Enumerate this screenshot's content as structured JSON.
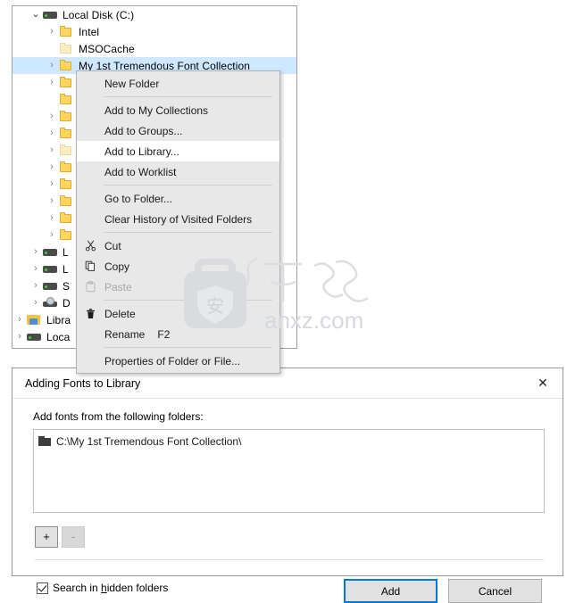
{
  "tree": {
    "rows": [
      {
        "label": "Local Disk (C:)",
        "icon": "drive-icon",
        "indent": 1,
        "twisty": "expanded",
        "selected": false
      },
      {
        "label": "Intel",
        "icon": "folder-icon",
        "indent": 2,
        "twisty": "collapsed",
        "selected": false
      },
      {
        "label": "MSOCache",
        "icon": "folder-pale-icon",
        "indent": 2,
        "twisty": "none",
        "selected": false
      },
      {
        "label": "My 1st Tremendous Font Collection",
        "icon": "folder-icon",
        "indent": 2,
        "twisty": "collapsed",
        "selected": true
      },
      {
        "label": "",
        "icon": "folder-icon",
        "indent": 2,
        "twisty": "collapsed",
        "selected": false
      },
      {
        "label": "",
        "icon": "folder-icon",
        "indent": 2,
        "twisty": "none",
        "selected": false
      },
      {
        "label": "",
        "icon": "folder-icon",
        "indent": 2,
        "twisty": "collapsed",
        "selected": false
      },
      {
        "label": "",
        "icon": "folder-icon",
        "indent": 2,
        "twisty": "collapsed",
        "selected": false
      },
      {
        "label": "",
        "icon": "folder-pale-icon",
        "indent": 2,
        "twisty": "collapsed",
        "selected": false
      },
      {
        "label": "",
        "icon": "folder-icon",
        "indent": 2,
        "twisty": "collapsed",
        "selected": false
      },
      {
        "label": "",
        "icon": "folder-icon",
        "indent": 2,
        "twisty": "collapsed",
        "selected": false
      },
      {
        "label": "",
        "icon": "folder-icon",
        "indent": 2,
        "twisty": "collapsed",
        "selected": false
      },
      {
        "label": "",
        "icon": "folder-icon",
        "indent": 2,
        "twisty": "collapsed",
        "selected": false
      },
      {
        "label": "",
        "icon": "folder-icon",
        "indent": 2,
        "twisty": "collapsed",
        "selected": false
      },
      {
        "label": "L",
        "icon": "drive-icon",
        "indent": 1,
        "twisty": "collapsed",
        "selected": false
      },
      {
        "label": "L",
        "icon": "drive-icon",
        "indent": 1,
        "twisty": "collapsed",
        "selected": false
      },
      {
        "label": "S",
        "icon": "drive-icon",
        "indent": 1,
        "twisty": "collapsed",
        "selected": false
      },
      {
        "label": "D",
        "icon": "disc-icon",
        "indent": 1,
        "twisty": "collapsed",
        "selected": false
      },
      {
        "label": "Libra",
        "icon": "library-icon",
        "indent": 0,
        "twisty": "collapsed",
        "selected": false
      },
      {
        "label": "Loca",
        "icon": "drive-icon",
        "indent": 0,
        "twisty": "collapsed",
        "selected": false
      },
      {
        "label": "Loca",
        "icon": "drive-icon",
        "indent": 0,
        "twisty": "collapsed",
        "selected": false
      }
    ]
  },
  "context_menu": {
    "items": [
      {
        "label": "New Folder",
        "icon": "",
        "hovered": false,
        "disabled": false,
        "shortcut": ""
      },
      {
        "separator": true
      },
      {
        "label": "Add to My Collections",
        "icon": "",
        "hovered": false,
        "disabled": false,
        "shortcut": ""
      },
      {
        "label": "Add to Groups...",
        "icon": "",
        "hovered": false,
        "disabled": false,
        "shortcut": ""
      },
      {
        "label": "Add to Library...",
        "icon": "",
        "hovered": true,
        "disabled": false,
        "shortcut": ""
      },
      {
        "label": "Add to Worklist",
        "icon": "",
        "hovered": false,
        "disabled": false,
        "shortcut": ""
      },
      {
        "separator": true
      },
      {
        "label": "Go to Folder...",
        "icon": "",
        "hovered": false,
        "disabled": false,
        "shortcut": ""
      },
      {
        "label": "Clear History of Visited Folders",
        "icon": "",
        "hovered": false,
        "disabled": false,
        "shortcut": ""
      },
      {
        "separator": true
      },
      {
        "label": "Cut",
        "icon": "cut-icon",
        "glyph": "✂",
        "hovered": false,
        "disabled": false,
        "shortcut": ""
      },
      {
        "label": "Copy",
        "icon": "copy-icon",
        "glyph": "❐",
        "hovered": false,
        "disabled": false,
        "shortcut": ""
      },
      {
        "label": "Paste",
        "icon": "paste-icon",
        "glyph": "ὌB",
        "hovered": false,
        "disabled": true,
        "shortcut": ""
      },
      {
        "separator": true
      },
      {
        "label": "Delete",
        "icon": "trash-icon",
        "glyph": "Ὕ1",
        "hovered": false,
        "disabled": false,
        "shortcut": ""
      },
      {
        "label": "Rename",
        "icon": "",
        "hovered": false,
        "disabled": false,
        "shortcut": "F2"
      },
      {
        "separator": true
      },
      {
        "label": "Properties of Folder or File...",
        "icon": "",
        "hovered": false,
        "disabled": false,
        "shortcut": ""
      }
    ]
  },
  "dialog": {
    "title": "Adding Fonts to Library",
    "close_label": "✕",
    "folders_caption": "Add fonts from the following folders:",
    "folders": [
      {
        "path": "C:\\My 1st Tremendous Font Collection\\",
        "icon": "folder-dark-icon"
      }
    ],
    "add_folder_label": "+",
    "remove_folder_label": "-",
    "hidden_checkbox": {
      "prefix": "Search in ",
      "accesskey": "h",
      "suffix": "idden folders",
      "checked": true
    },
    "primary_button": "Add",
    "secondary_button": "Cancel"
  },
  "watermark": {
    "text": "anxz.com",
    "glyph": "安",
    "cn_text": "安下载",
    "color": "#d8dade"
  }
}
